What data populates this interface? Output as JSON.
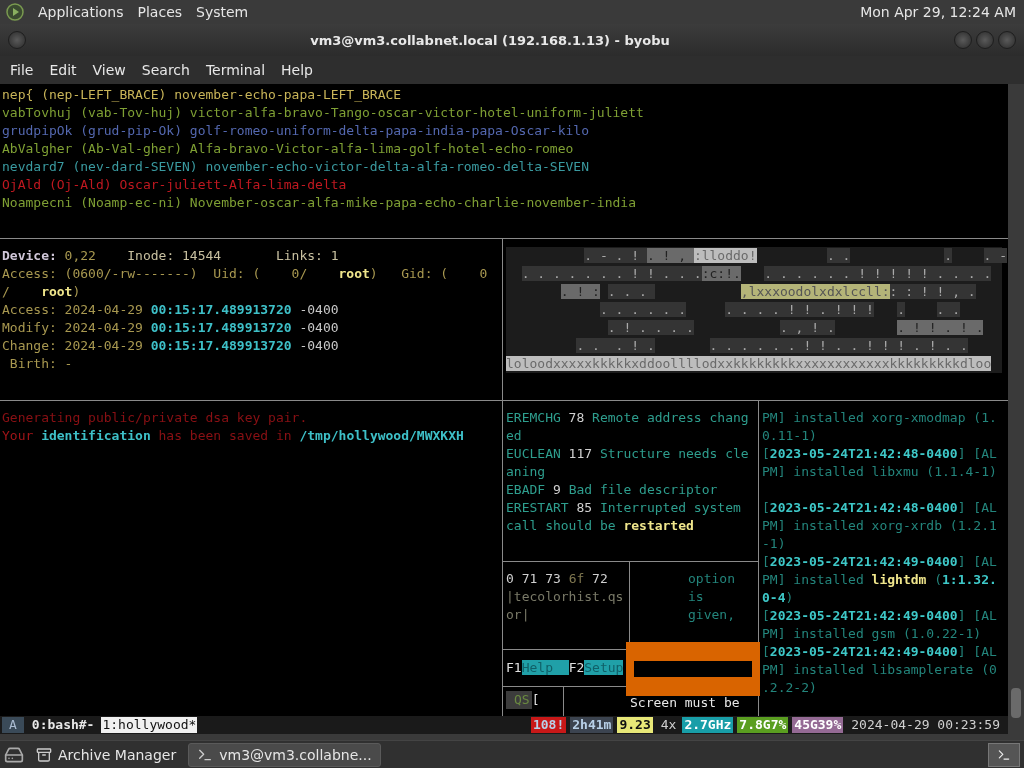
{
  "top_panel": {
    "menus": [
      "Applications",
      "Places",
      "System"
    ],
    "clock": "Mon Apr 29, 12:24 AM"
  },
  "window": {
    "title": "vm3@vm3.collabnet.local (192.168.1.13) - byobu"
  },
  "menu_bar": [
    "File",
    "Edit",
    "View",
    "Search",
    "Terminal",
    "Help"
  ],
  "names_pane": {
    "lines": [
      {
        "segments": [
          {
            "text": "nep{ (nep-LEFT_BRACE) november-echo-papa-LEFT_BRACE",
            "color": "#c8b458"
          }
        ]
      },
      {
        "segments": [
          {
            "text": "vabTovhuj (vab-Tov-huj) victor-alfa-bravo-Tango-oscar-victor-hotel-uniform-juliett",
            "color": "#7fa034"
          }
        ]
      },
      {
        "segments": [
          {
            "text": "grudpipOk (grud-pip-Ok) golf-romeo-uniform-delta-papa-india-papa-Oscar-kilo",
            "color": "#5468b0"
          }
        ]
      },
      {
        "segments": [
          {
            "text": "AbValgher (Ab-Val-gher) Alfa-bravo-Victor-alfa-lima-golf-hotel-echo-romeo",
            "color": "#7fa034"
          }
        ]
      },
      {
        "segments": [
          {
            "text": "nevdard7 (nev-dard-SEVEN) november-echo-victor-delta-alfa-romeo-delta-SEVEN",
            "color": "#3a9aa0"
          }
        ]
      },
      {
        "segments": [
          {
            "text": "OjAld (Oj-Ald) Oscar-juliett-Alfa-lima-delta",
            "color": "#c01820"
          }
        ]
      },
      {
        "segments": [
          {
            "text": "Noampecni (Noamp-ec-ni) November-oscar-alfa-mike-papa-echo-charlie-november-india",
            "color": "#7fa034"
          }
        ]
      }
    ]
  },
  "stat_pane": {
    "lines": [
      {
        "segments": [
          {
            "text": "Device:",
            "color": "#cfc6d8",
            "bold": true
          },
          {
            "text": " 0,22    ",
            "color": "#a89850"
          },
          {
            "text": "Inode: 14544       Links: 1",
            "color": "#c8c0a0"
          }
        ]
      },
      {
        "segments": [
          {
            "text": "Access: (0600/-rw-------)  Uid: (    0/    ",
            "color": "#a89850"
          },
          {
            "text": "root",
            "color": "#f0e68c",
            "bold": true
          },
          {
            "text": ")   Gid: (    0",
            "color": "#a89850"
          }
        ]
      },
      {
        "segments": [
          {
            "text": "/    ",
            "color": "#a89850"
          },
          {
            "text": "root",
            "color": "#f0e68c",
            "bold": true
          },
          {
            "text": ")",
            "color": "#a89850"
          }
        ]
      },
      {
        "segments": [
          {
            "text": "Access: 2024-04-29 ",
            "color": "#a89850"
          },
          {
            "text": "00:15:17.489913720",
            "color": "#3ec0c8",
            "bold": true
          },
          {
            "text": " -0400",
            "color": "#c8c8c8"
          }
        ]
      },
      {
        "segments": [
          {
            "text": "Modify: 2024-04-29 ",
            "color": "#a89850"
          },
          {
            "text": "00:15:17.489913720",
            "color": "#3ec0c8",
            "bold": true
          },
          {
            "text": " -0400",
            "color": "#c8c8c8"
          }
        ]
      },
      {
        "segments": [
          {
            "text": "Change: 2024-04-29 ",
            "color": "#a89850"
          },
          {
            "text": "00:15:17.489913720",
            "color": "#3ec0c8",
            "bold": true
          },
          {
            "text": " -0400",
            "color": "#c8c8c8"
          }
        ]
      },
      {
        "segments": [
          {
            "text": " Birth: -",
            "color": "#a89850"
          }
        ]
      }
    ]
  },
  "ascii_art": {
    "rows": [
      {
        "segments": [
          {
            "text": "          . - . ! ",
            "kind": "shade"
          },
          {
            "text": ". ! , ",
            "kind": "mid"
          },
          {
            "text": ":lloddo!",
            "kind": "lit"
          },
          {
            "text": "         . .",
            "kind": "shade"
          },
          {
            "text": "            .",
            "kind": "shade"
          },
          {
            "text": "    . -",
            "kind": "shade"
          }
        ]
      },
      {
        "segments": [
          {
            "text": "  . . . . . . . ! ! . . .",
            "kind": "shade"
          },
          {
            "text": ":c:!.",
            "kind": "mid"
          },
          {
            "text": "   . . . . . . ! ! ! ! ! . . . .",
            "kind": "shade"
          }
        ]
      },
      {
        "segments": [
          {
            "text": "       . ! :",
            "kind": "mid"
          },
          {
            "text": " . . . ",
            "kind": "shade"
          },
          {
            "text": "           ,lxxxoodolxdxlccll:",
            "kind": "glow"
          },
          {
            "text": ": : ! ! , .",
            "kind": "shade"
          }
        ]
      },
      {
        "segments": [
          {
            "text": "            . . . . . .",
            "kind": "shade"
          },
          {
            "text": "     . . . . ! ! . ! ! !",
            "kind": "shade"
          },
          {
            "text": "   .",
            "kind": "shade"
          },
          {
            "text": "    . .",
            "kind": "shade"
          }
        ]
      },
      {
        "segments": [
          {
            "text": "             . ! . . . .",
            "kind": "shade"
          },
          {
            "text": "           . , ! .",
            "kind": "shade"
          },
          {
            "text": "        . ! ! . ! .",
            "kind": "mid"
          }
        ]
      },
      {
        "segments": [
          {
            "text": "         . .  . ! .",
            "kind": "shade"
          },
          {
            "text": "       . . . . . . ! ! . . ! ! ! . ! . .",
            "kind": "shade"
          }
        ]
      },
      {
        "segments": [
          {
            "text": "loloodxxxxxkkkkkxddoollllodxxkkkkkkkkxxxxxxxxxxxxkkkkkkkkkdloo",
            "kind": "lit"
          }
        ]
      }
    ]
  },
  "keygen_pane": {
    "lines": [
      {
        "segments": [
          {
            "text": "Generating public/private dsa key pair.",
            "color": "#8a1014"
          }
        ]
      },
      {
        "segments": [
          {
            "text": "Your ",
            "color": "#a01418"
          },
          {
            "text": "identification",
            "color": "#3ec0c8",
            "bold": true
          },
          {
            "text": " has been saved in ",
            "color": "#8a1014"
          },
          {
            "text": "/tmp/hollywood/MWXKXH",
            "color": "#3ec0c8",
            "bold": true
          }
        ]
      }
    ]
  },
  "errno_pane": {
    "lines": [
      {
        "segments": [
          {
            "text": "EREMCHG",
            "color": "#2e9e8e"
          },
          {
            "text": " 78 ",
            "color": "#d0d0d0"
          },
          {
            "text": "Remote address chang",
            "color": "#2e9e8e"
          }
        ]
      },
      {
        "segments": [
          {
            "text": "ed",
            "color": "#2e9e8e"
          }
        ]
      },
      {
        "segments": [
          {
            "text": "EUCLEAN",
            "color": "#2e9e8e"
          },
          {
            "text": " 117 ",
            "color": "#d0d0d0"
          },
          {
            "text": "Structure needs cle",
            "color": "#2e9e8e"
          }
        ]
      },
      {
        "segments": [
          {
            "text": "aning",
            "color": "#2e9e8e"
          }
        ]
      },
      {
        "segments": [
          {
            "text": "EBADF",
            "color": "#2e9e8e"
          },
          {
            "text": " 9 ",
            "color": "#d0d0d0"
          },
          {
            "text": "Bad file descriptor",
            "color": "#2e9e8e"
          }
        ]
      },
      {
        "segments": [
          {
            "text": "ERESTART",
            "color": "#2e9e8e"
          },
          {
            "text": " 85 ",
            "color": "#d0d0d0"
          },
          {
            "text": "Interrupted system",
            "color": "#2e9e8e"
          }
        ]
      },
      {
        "segments": [
          {
            "text": "call should be ",
            "color": "#2e9e8e"
          },
          {
            "text": "restarted",
            "color": "#f0e68c",
            "bold": true
          }
        ]
      }
    ]
  },
  "log_pane": {
    "lines": [
      {
        "kind": "text",
        "segments": [
          {
            "text": "PM] installed xorg-xmodmap (1.",
            "color": "#23857c"
          }
        ]
      },
      {
        "kind": "text",
        "segments": [
          {
            "text": "0.11-1)",
            "color": "#23857c"
          }
        ]
      },
      {
        "kind": "text",
        "segments": [
          {
            "text": "[",
            "color": "#23857c"
          },
          {
            "text": "2023-05-24T21:42:48-0400",
            "color": "#3ec8c8",
            "bold": true
          },
          {
            "text": "] [AL",
            "color": "#23857c"
          }
        ]
      },
      {
        "kind": "text",
        "segments": [
          {
            "text": "PM] installed libxmu (1.1.4-1)",
            "color": "#23857c"
          }
        ]
      },
      {
        "kind": "blank"
      },
      {
        "kind": "text",
        "segments": [
          {
            "text": "[",
            "color": "#23857c"
          },
          {
            "text": "2023-05-24T21:42:48-0400",
            "color": "#3ec8c8",
            "bold": true
          },
          {
            "text": "] [AL",
            "color": "#23857c"
          }
        ]
      },
      {
        "kind": "text",
        "segments": [
          {
            "text": "PM] installed xorg-xrdb (1.2.1",
            "color": "#23857c"
          }
        ]
      },
      {
        "kind": "text",
        "segments": [
          {
            "text": "-1)",
            "color": "#23857c"
          }
        ]
      },
      {
        "kind": "text",
        "segments": [
          {
            "text": "[",
            "color": "#23857c"
          },
          {
            "text": "2023-05-24T21:42:49-0400",
            "color": "#3ec8c8",
            "bold": true
          },
          {
            "text": "] [AL",
            "color": "#23857c"
          }
        ]
      },
      {
        "kind": "text",
        "segments": [
          {
            "text": "PM] installed ",
            "color": "#23857c"
          },
          {
            "text": "lightdm",
            "color": "#f0e68c",
            "bold": true
          },
          {
            "text": " (",
            "color": "#23857c"
          },
          {
            "text": "1:1.32.",
            "color": "#3ec8c8",
            "bold": true
          }
        ]
      },
      {
        "kind": "text",
        "segments": [
          {
            "text": "0-4",
            "color": "#3ec8c8",
            "bold": true
          },
          {
            "text": ")",
            "color": "#23857c"
          }
        ]
      },
      {
        "kind": "text",
        "segments": [
          {
            "text": "[",
            "color": "#23857c"
          },
          {
            "text": "2023-05-24T21:42:49-0400",
            "color": "#3ec8c8",
            "bold": true
          },
          {
            "text": "] [AL",
            "color": "#23857c"
          }
        ]
      },
      {
        "kind": "text",
        "segments": [
          {
            "text": "PM] installed gsm (1.0.22-1)",
            "color": "#23857c"
          }
        ]
      },
      {
        "kind": "text",
        "segments": [
          {
            "text": "[",
            "color": "#23857c"
          },
          {
            "text": "2023-05-24T21:42:49-0400",
            "color": "#3ec8c8",
            "bold": true
          },
          {
            "text": "] [AL",
            "color": "#23857c"
          }
        ]
      },
      {
        "kind": "text",
        "segments": [
          {
            "text": "PM] installed libsamplerate (0",
            "color": "#23857c"
          }
        ]
      },
      {
        "kind": "text",
        "segments": [
          {
            "text": ".2.2-2)",
            "color": "#23857c"
          }
        ]
      }
    ]
  },
  "hex_pane": {
    "lines": [
      {
        "segments": [
          {
            "text": "0 71 73 ",
            "color": "#d0d0d0"
          },
          {
            "text": "6f",
            "color": "#807850"
          },
          {
            "text": " 72",
            "color": "#d0d0d0"
          }
        ]
      },
      {
        "segments": [
          {
            "text": "|tecolorhist.qs",
            "color": "#7a7a68"
          }
        ]
      },
      {
        "segments": [
          {
            "text": "or|",
            "color": "#7a7a68"
          }
        ]
      }
    ]
  },
  "option_pane": {
    "lines": [
      "option",
      "is",
      "given,"
    ]
  },
  "function_keys": [
    {
      "key": "F1",
      "label": "Help  "
    },
    {
      "key": "F2",
      "label": "Setup"
    }
  ],
  "qs_pane": {
    "label": "QS",
    "bracket": "["
  },
  "screen_pane": {
    "text": "Screen must be"
  },
  "status_bar": {
    "session": "A",
    "windows": [
      {
        "label": "0:bash#-",
        "selected": false
      },
      {
        "label": "1:hollywood*",
        "selected": true
      }
    ],
    "indicators": [
      {
        "text": "108!",
        "color": "#c81818"
      },
      {
        "text": "2h41m",
        "color": "#3c4450"
      },
      {
        "text": "9.23",
        "color": "#e8e878"
      },
      {
        "text": "4x"
      },
      {
        "text": "2.7GHz",
        "color": "#189ea8"
      },
      {
        "text": "7.8G7%",
        "color": "#5a9e20"
      },
      {
        "text": "45G39%",
        "color": "#946a94"
      },
      {
        "text": "2024-04-29 00:23:59"
      }
    ]
  },
  "taskbar": {
    "tasks": [
      {
        "label": "Archive Manager",
        "selected": false
      },
      {
        "label": "vm3@vm3.collabne...",
        "selected": true
      }
    ]
  }
}
